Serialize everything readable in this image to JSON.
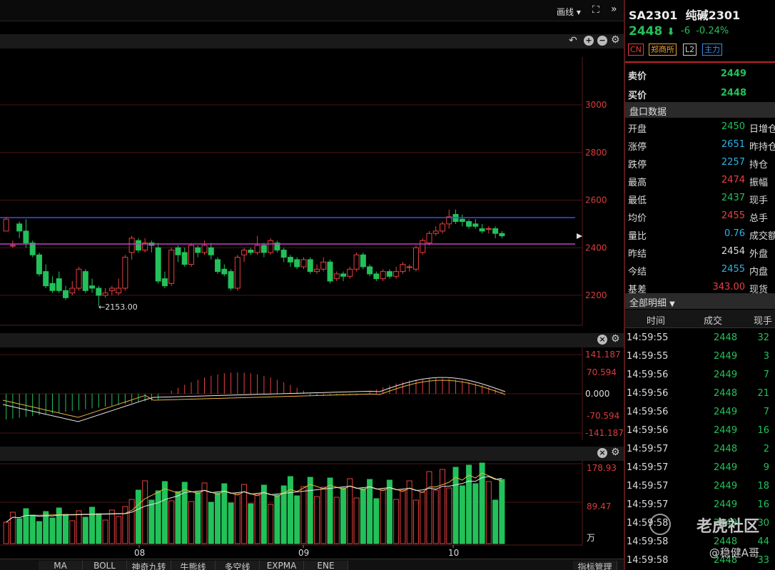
{
  "toolbar": {
    "draw_label": "画线",
    "draw_arrow": "▾",
    "fullscreen_icon": "expand-icon",
    "collapse_icon": "double-chevron-right-icon"
  },
  "main_chart": {
    "title_tools": {
      "undo": "↶",
      "zoom_in": "+",
      "zoom_out": "−",
      "settings": "⚙"
    },
    "y_ticks": [
      "3000",
      "2800",
      "2600",
      "2400",
      "2200"
    ],
    "min_label": "←2153.00",
    "colors": {
      "up": "#e8413f",
      "down": "#23c15a",
      "blue_line": "#3a4ee8",
      "magenta_line": "#c83cc8"
    }
  },
  "chart_data": [
    {
      "type": "candlestick",
      "title": "",
      "ylim": [
        2100,
        3100
      ],
      "y_ticks": [
        3000,
        2800,
        2600,
        2400,
        2200
      ],
      "min_marker": 2153.0,
      "horizontal_lines": [
        2527,
        2417
      ],
      "candles": [
        [
          2470,
          2520,
          2530,
          2470
        ],
        [
          2410,
          2410,
          2430,
          2400
        ],
        [
          2500,
          2470,
          2510,
          2440
        ],
        [
          2470,
          2420,
          2520,
          2400
        ],
        [
          2420,
          2370,
          2430,
          2360
        ],
        [
          2370,
          2290,
          2380,
          2280
        ],
        [
          2300,
          2240,
          2330,
          2230
        ],
        [
          2250,
          2220,
          2280,
          2210
        ],
        [
          2270,
          2220,
          2300,
          2210
        ],
        [
          2220,
          2190,
          2240,
          2180
        ],
        [
          2210,
          2230,
          2260,
          2200
        ],
        [
          2230,
          2310,
          2320,
          2220
        ],
        [
          2300,
          2220,
          2310,
          2210
        ],
        [
          2240,
          2230,
          2270,
          2210
        ],
        [
          2230,
          2200,
          2240,
          2153
        ],
        [
          2200,
          2210,
          2230,
          2190
        ],
        [
          2220,
          2230,
          2240,
          2200
        ],
        [
          2210,
          2230,
          2270,
          2200
        ],
        [
          2230,
          2360,
          2370,
          2220
        ],
        [
          2380,
          2440,
          2450,
          2350
        ],
        [
          2430,
          2390,
          2440,
          2380
        ],
        [
          2390,
          2420,
          2440,
          2380
        ],
        [
          2420,
          2410,
          2430,
          2380
        ],
        [
          2400,
          2260,
          2420,
          2250
        ],
        [
          2270,
          2240,
          2300,
          2230
        ],
        [
          2250,
          2390,
          2400,
          2240
        ],
        [
          2400,
          2370,
          2410,
          2340
        ],
        [
          2380,
          2330,
          2400,
          2320
        ],
        [
          2330,
          2410,
          2420,
          2320
        ],
        [
          2400,
          2380,
          2410,
          2360
        ],
        [
          2380,
          2410,
          2430,
          2370
        ],
        [
          2400,
          2370,
          2420,
          2350
        ],
        [
          2350,
          2300,
          2360,
          2290
        ],
        [
          2310,
          2290,
          2330,
          2280
        ],
        [
          2300,
          2230,
          2310,
          2220
        ],
        [
          2230,
          2360,
          2370,
          2220
        ],
        [
          2370,
          2390,
          2400,
          2340
        ],
        [
          2390,
          2380,
          2400,
          2370
        ],
        [
          2380,
          2410,
          2450,
          2370
        ],
        [
          2410,
          2380,
          2420,
          2360
        ],
        [
          2380,
          2430,
          2440,
          2370
        ],
        [
          2420,
          2390,
          2430,
          2380
        ],
        [
          2390,
          2360,
          2400,
          2340
        ],
        [
          2360,
          2340,
          2370,
          2320
        ],
        [
          2350,
          2320,
          2360,
          2310
        ],
        [
          2320,
          2350,
          2360,
          2310
        ],
        [
          2350,
          2300,
          2360,
          2290
        ],
        [
          2300,
          2310,
          2330,
          2290
        ],
        [
          2310,
          2340,
          2360,
          2300
        ],
        [
          2340,
          2260,
          2350,
          2250
        ],
        [
          2270,
          2290,
          2300,
          2260
        ],
        [
          2290,
          2280,
          2300,
          2260
        ],
        [
          2280,
          2310,
          2320,
          2270
        ],
        [
          2310,
          2370,
          2380,
          2300
        ],
        [
          2370,
          2320,
          2380,
          2310
        ],
        [
          2320,
          2290,
          2330,
          2280
        ],
        [
          2290,
          2270,
          2300,
          2260
        ],
        [
          2270,
          2300,
          2310,
          2260
        ],
        [
          2300,
          2280,
          2310,
          2270
        ],
        [
          2280,
          2300,
          2320,
          2270
        ],
        [
          2300,
          2330,
          2340,
          2290
        ],
        [
          2320,
          2320,
          2330,
          2300
        ],
        [
          2310,
          2400,
          2410,
          2300
        ],
        [
          2380,
          2430,
          2440,
          2370
        ],
        [
          2420,
          2460,
          2470,
          2410
        ],
        [
          2460,
          2470,
          2490,
          2450
        ],
        [
          2470,
          2500,
          2510,
          2460
        ],
        [
          2500,
          2530,
          2560,
          2480
        ],
        [
          2540,
          2510,
          2560,
          2500
        ],
        [
          2520,
          2510,
          2540,
          2490
        ],
        [
          2510,
          2490,
          2520,
          2480
        ],
        [
          2500,
          2490,
          2520,
          2480
        ],
        [
          2480,
          2470,
          2500,
          2460
        ],
        [
          2480,
          2480,
          2490,
          2460
        ],
        [
          2480,
          2460,
          2490,
          2440
        ],
        [
          2460,
          2450,
          2470,
          2440
        ]
      ]
    },
    {
      "type": "macd",
      "y_ticks": [
        141.187,
        70.594,
        0.0,
        -70.594,
        -141.187
      ],
      "ylim": [
        -141.187,
        141.187
      ]
    },
    {
      "type": "bar",
      "title": "",
      "y_ticks": [
        178.93,
        89.47
      ],
      "unit": "万",
      "x_labels": [
        "08",
        "09",
        "10"
      ]
    }
  ],
  "sub_chart_tools": {
    "close": "×",
    "settings": "⚙"
  },
  "indicator_tabs": [
    "MA",
    "BOLL",
    "神奇九转",
    "牛熊线",
    "多空线",
    "EXPMA",
    "ENE"
  ],
  "indicator_manage": "指标管理",
  "quote": {
    "symbol": "SA2301",
    "name": "纯碱2301",
    "price": "2448",
    "change": "-6",
    "change_pct": "-0.24%",
    "tags": [
      {
        "label": "CN",
        "color": "#e83c3c"
      },
      {
        "label": "郑商所",
        "color": "#e8a23c"
      },
      {
        "label": "L2",
        "color": "#cccccc"
      },
      {
        "label": "主力",
        "color": "#3c8ce8"
      }
    ],
    "ask_label": "卖价",
    "ask": "2449",
    "bid_label": "买价",
    "bid": "2448"
  },
  "panel": {
    "title": "盘口数据",
    "rows": [
      {
        "label": "开盘",
        "value": "2450",
        "color": "green",
        "label2": "日增仓"
      },
      {
        "label": "涨停",
        "value": "2651",
        "color": "cyan",
        "label2": "昨持仓"
      },
      {
        "label": "跌停",
        "value": "2257",
        "color": "cyan",
        "label2": "持仓"
      },
      {
        "label": "最高",
        "value": "2474",
        "color": "red",
        "label2": "振幅"
      },
      {
        "label": "最低",
        "value": "2437",
        "color": "green",
        "label2": "现手"
      },
      {
        "label": "均价",
        "value": "2455",
        "color": "red",
        "label2": "总手"
      },
      {
        "label": "量比",
        "value": "0.76",
        "color": "cyan",
        "label2": "成交额"
      },
      {
        "label": "昨结",
        "value": "2454",
        "color": "white",
        "label2": "外盘"
      },
      {
        "label": "今结",
        "value": "2455",
        "color": "cyan",
        "label2": "内盘"
      },
      {
        "label": "基差",
        "value": "343.00",
        "color": "red",
        "label2": "现货"
      }
    ]
  },
  "trades": {
    "title": "全部明细",
    "headers": [
      "时间",
      "成交",
      "现手"
    ],
    "rows": [
      [
        "14:59:55",
        "2448",
        "32"
      ],
      [
        "14:59:55",
        "2449",
        "3"
      ],
      [
        "14:59:56",
        "2449",
        "7"
      ],
      [
        "14:59:56",
        "2448",
        "21"
      ],
      [
        "14:59:56",
        "2449",
        "7"
      ],
      [
        "14:59:56",
        "2449",
        "16"
      ],
      [
        "14:59:57",
        "2448",
        "2"
      ],
      [
        "14:59:57",
        "2449",
        "9"
      ],
      [
        "14:59:57",
        "2449",
        "18"
      ],
      [
        "14:59:57",
        "2449",
        "16"
      ],
      [
        "14:59:58",
        "2449",
        "30"
      ],
      [
        "14:59:58",
        "2448",
        "44"
      ],
      [
        "14:59:58",
        "2448",
        "33"
      ]
    ]
  },
  "watermark": {
    "brand": "老虎社区",
    "user": "@稳健A哥"
  }
}
